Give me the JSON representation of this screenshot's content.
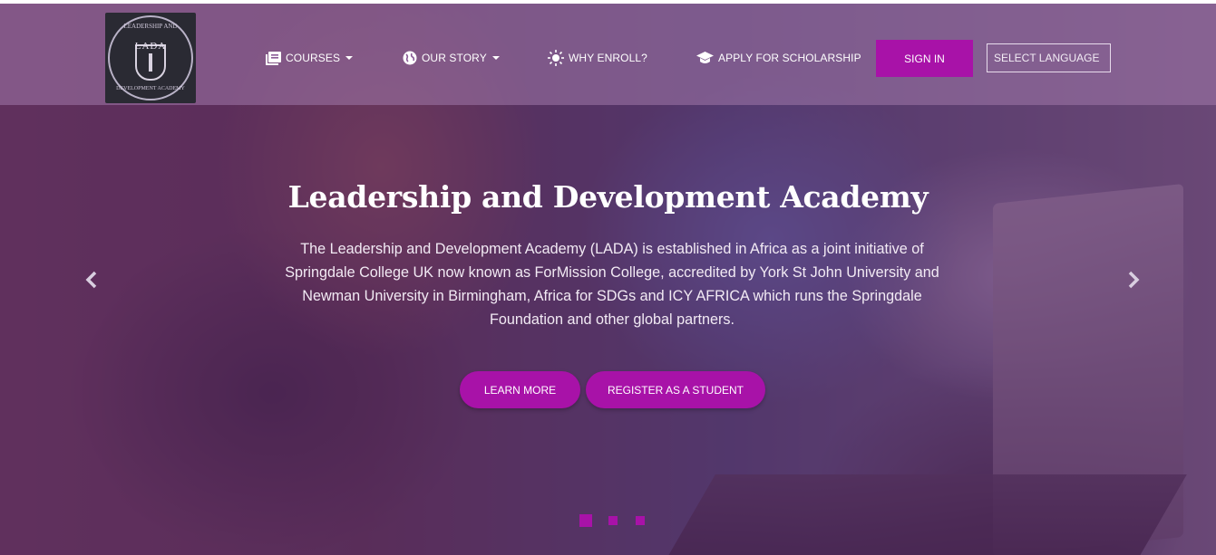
{
  "logo": {
    "arc_top": "LEADERSHIP AND",
    "center": "LADA",
    "arc_bottom": "DEVELOPMENT ACADEMY"
  },
  "nav": {
    "courses": {
      "label": "COURSES",
      "icon": "book-icon"
    },
    "our_story": {
      "label": "OUR STORY",
      "icon": "globe-icon"
    },
    "why_enroll": {
      "label": "WHY ENROLL?",
      "icon": "sun-icon"
    },
    "scholarship": {
      "label": "APPLY FOR SCHOLARSHIP",
      "icon": "graduation-cap-icon"
    },
    "sign_in": "SIGN IN",
    "language": "SELECT LANGUAGE"
  },
  "hero": {
    "title": "Leadership and Development Academy",
    "description": "The Leadership and Development Academy (LADA) is established in Africa as a joint initiative of Springdale College UK now known as ForMission College, accredited by York St John University and Newman University in Birmingham, Africa for SDGs and ICY AFRICA which runs the Springdale Foundation and other global partners.",
    "learn_more": "LEARN MORE",
    "register": "REGISTER AS A STUDENT"
  },
  "carousel": {
    "prev_icon": "chevron-left-icon",
    "next_icon": "chevron-right-icon",
    "slide_count": 3,
    "active_slide": 1
  },
  "colors": {
    "accent": "#a812a8",
    "overlay": "#66286e",
    "navbar": "#a078aa"
  }
}
